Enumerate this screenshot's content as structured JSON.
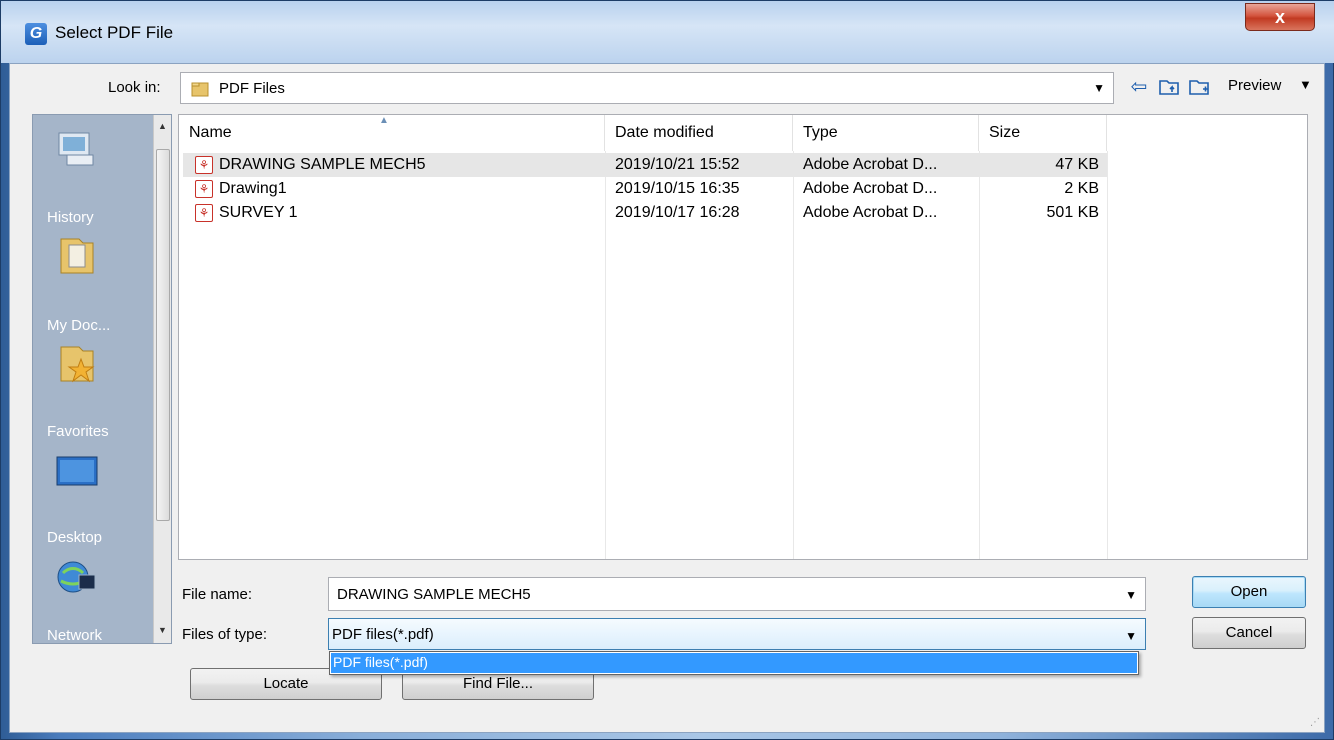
{
  "window": {
    "title": "Select PDF File",
    "app_icon_letter": "G",
    "close_glyph": "x"
  },
  "toolbar": {
    "look_in_label": "Look in:",
    "look_in_value": "PDF Files",
    "back_icon": "back-arrow-icon",
    "up_folder_icon": "up-folder-icon",
    "new_folder_icon": "new-folder-icon",
    "preview_label": "Preview"
  },
  "places": [
    {
      "label": "History",
      "icon": "history-icon"
    },
    {
      "label": "My Doc...",
      "icon": "documents-folder-icon"
    },
    {
      "label": "Favorites",
      "icon": "favorites-folder-icon"
    },
    {
      "label": "Desktop",
      "icon": "desktop-icon"
    },
    {
      "label": "Network",
      "icon": "network-icon"
    }
  ],
  "filelist": {
    "columns": [
      "Name",
      "Date modified",
      "Type",
      "Size"
    ],
    "rows": [
      {
        "name": "DRAWING SAMPLE MECH5",
        "date": "2019/10/21 15:52",
        "type": "Adobe Acrobat D...",
        "size": "47 KB",
        "selected": true
      },
      {
        "name": "Drawing1",
        "date": "2019/10/15 16:35",
        "type": "Adobe Acrobat D...",
        "size": "2 KB",
        "selected": false
      },
      {
        "name": "SURVEY 1",
        "date": "2019/10/17 16:28",
        "type": "Adobe Acrobat D...",
        "size": "501 KB",
        "selected": false
      }
    ]
  },
  "form": {
    "file_name_label": "File name:",
    "file_name_value": "DRAWING SAMPLE MECH5",
    "files_of_type_label": "Files of type:",
    "files_of_type_value": "PDF files(*.pdf)",
    "dropdown_options": [
      "PDF files(*.pdf)"
    ]
  },
  "buttons": {
    "open": "Open",
    "cancel": "Cancel",
    "locate": "Locate",
    "find_file": "Find File..."
  }
}
